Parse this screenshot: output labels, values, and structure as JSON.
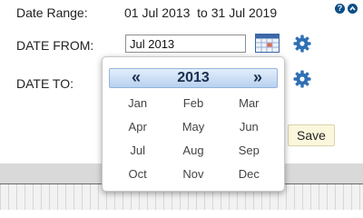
{
  "date_range": {
    "label": "Date Range:",
    "value": "01 Jul 2013  to 31 Jul 2019"
  },
  "header_icons": {
    "help": "?",
    "collapse": "^"
  },
  "date_from": {
    "label": "DATE FROM:",
    "value": "Jul 2013"
  },
  "date_to": {
    "label": "DATE TO:"
  },
  "save_label": "Save",
  "picker": {
    "prev": "«",
    "year": "2013",
    "next": "»",
    "months": [
      "Jan",
      "Feb",
      "Mar",
      "Apr",
      "May",
      "Jun",
      "Jul",
      "Aug",
      "Sep",
      "Oct",
      "Nov",
      "Dec"
    ]
  },
  "colors": {
    "accent": "#0b4f86",
    "header_text": "#1a2f4f",
    "save_bg": "#fbf7dc"
  },
  "icons": [
    "help-icon",
    "collapse-icon",
    "calendar-icon",
    "gear-icon"
  ]
}
